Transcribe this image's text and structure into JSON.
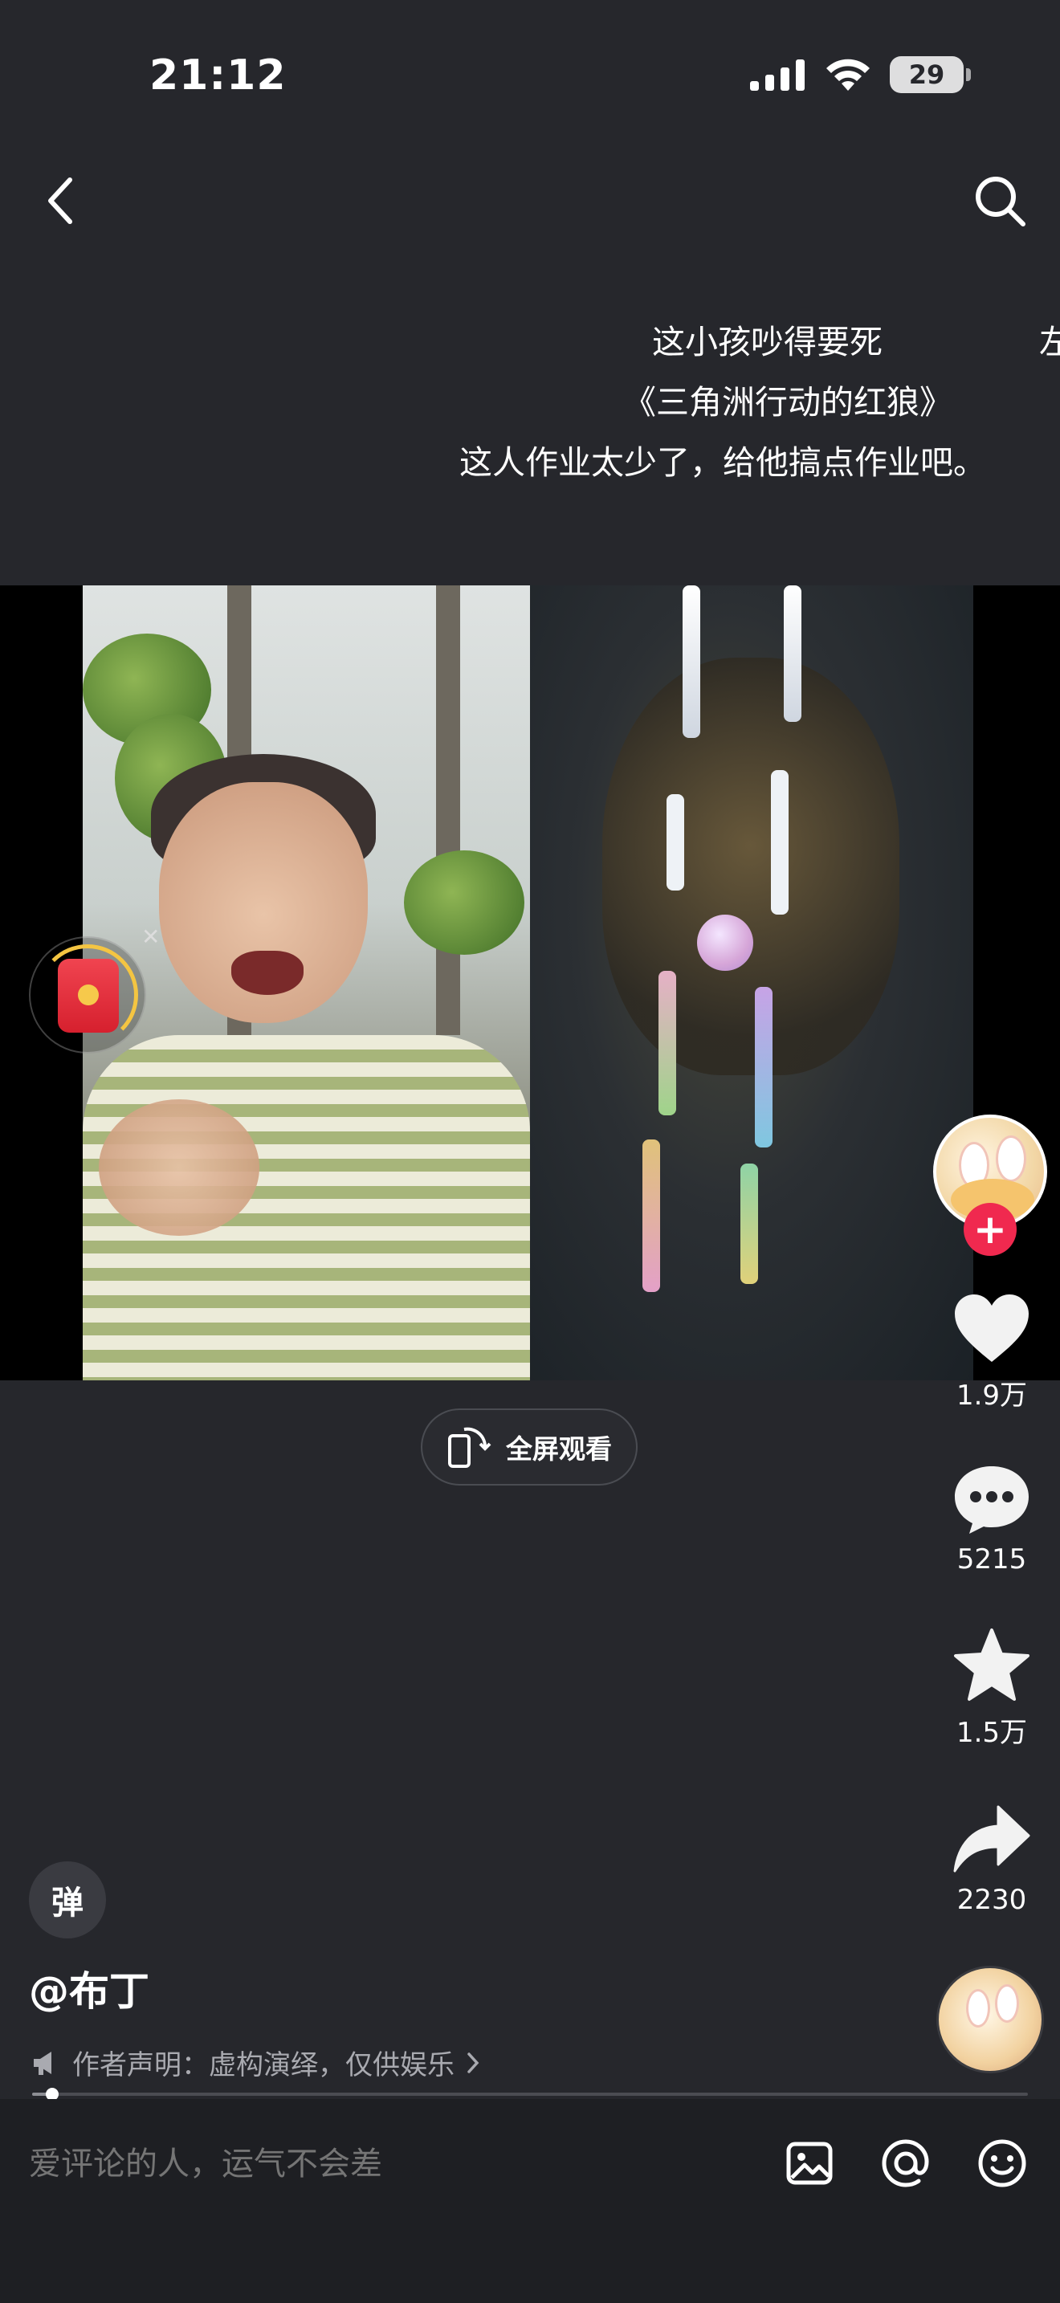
{
  "status_bar": {
    "time": "21:12",
    "battery": "29"
  },
  "danmaku": [
    {
      "text": "这小孩吵得要死"
    },
    {
      "text": "左"
    },
    {
      "text": "《三角洲行动的红狼》"
    },
    {
      "text": "这人作业太少了，给他搞点作业吧。"
    }
  ],
  "fullscreen_button": {
    "label": "全屏观看"
  },
  "actions": {
    "like_count": "1.9万",
    "comment_count": "5215",
    "favorite_count": "1.5万",
    "share_count": "2230"
  },
  "follow_symbol": "+",
  "danmu_toggle": "弹",
  "author": "@布丁",
  "declaration": "作者声明：虚构演绎，仅供娱乐",
  "progress": 0.02,
  "comment": {
    "placeholder": "爱评论的人，运气不会差"
  },
  "colors": {
    "background": "#26272c",
    "follow": "#f0294f",
    "redpacket": "#e12a35"
  },
  "icons": [
    "back-arrow-icon",
    "search-icon",
    "signal-icon",
    "wifi-icon",
    "battery-icon",
    "heart-icon",
    "comment-bubble-icon",
    "star-icon",
    "share-arrow-icon",
    "image-icon",
    "at-icon",
    "emoji-icon",
    "megaphone-icon",
    "rotate-phone-icon",
    "red-packet-icon"
  ]
}
